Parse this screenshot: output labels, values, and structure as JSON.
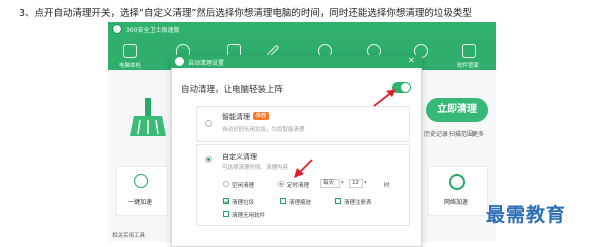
{
  "caption": "3、点开自动清理开关，选择“自定义清理”然后选择你想清理电脑的时间，同时还能选择你想清理的垃圾类型",
  "app": {
    "title": "360安全卫士极速版",
    "tabs": [
      {
        "label": "电脑体检",
        "icon": "monitor-icon"
      },
      {
        "label": "",
        "icon": "shield-icon"
      },
      {
        "label": "",
        "icon": "broom-icon"
      },
      {
        "label": "",
        "icon": "wrench-icon"
      },
      {
        "label": "",
        "icon": "wifi-icon"
      },
      {
        "label": "",
        "icon": "y-icon"
      },
      {
        "label": "",
        "icon": "rocket-icon"
      },
      {
        "label": "软件管家",
        "icon": "apps-icon"
      }
    ],
    "bg_heading_char": "清",
    "start_button": "立即清理",
    "links": {
      "history": "历史记录",
      "scan_settings": "扫描范围",
      "more": "更多"
    },
    "tiles": [
      {
        "label": "一键加速",
        "icon": "rocket-icon"
      },
      {
        "label": "网络加速",
        "icon": "speed-icon"
      }
    ],
    "bottom_link": "相关实用工具"
  },
  "dialog": {
    "title": "自动清理设置",
    "close": "✕",
    "auto_clean_text": "自动清理，让电脑轻装上阵",
    "toggle_on": true,
    "smart": {
      "title": "智能清理",
      "badge": "推荐",
      "desc": "自动识别无用垃圾，为您智能清理"
    },
    "custom": {
      "title": "自定义清理",
      "desc": "可选择清理时间、清理内容",
      "idle": "空闲清理",
      "timed": "定时清理",
      "freq": "每天",
      "hour": "12",
      "hour_unit": "时",
      "checks": [
        {
          "label": "清理垃圾",
          "checked": true
        },
        {
          "label": "清理痕迹",
          "checked": false
        },
        {
          "label": "清理注册表",
          "checked": false
        },
        {
          "label": "清理无用软件",
          "checked": false
        }
      ]
    }
  },
  "watermark": "最需教育",
  "colors": {
    "brand_green": "#2fae6c",
    "arrow_red": "#e0202a",
    "watermark_blue": "#2d6fb6",
    "badge_orange": "#ff7a2a"
  }
}
